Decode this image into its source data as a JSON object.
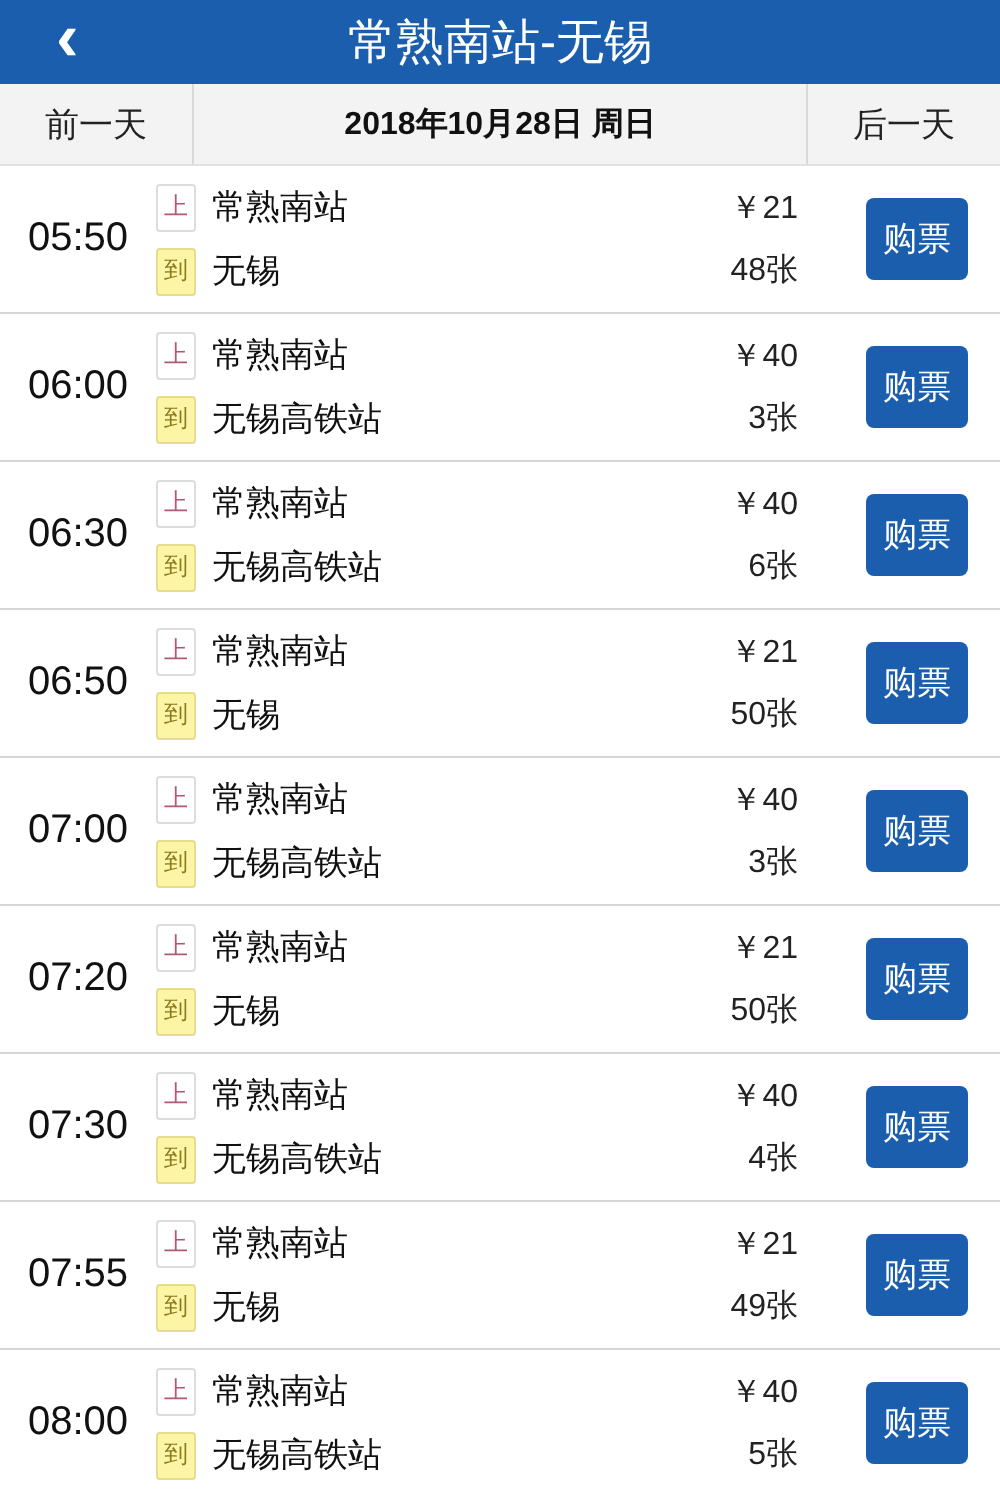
{
  "header": {
    "back": "‹",
    "title": "常熟南站-无锡"
  },
  "date_bar": {
    "prev": "前一天",
    "date": "2018年10月28日 周日",
    "next": "后一天"
  },
  "trains": [
    {
      "time": "05:50",
      "depart_tag": "上",
      "depart": "常熟南站",
      "arrive_tag": "到",
      "arrive": "无锡",
      "price": "￥21",
      "tickets": "48张",
      "button": "购票"
    },
    {
      "time": "06:00",
      "depart_tag": "上",
      "depart": "常熟南站",
      "arrive_tag": "到",
      "arrive": "无锡高铁站",
      "price": "￥40",
      "tickets": "3张",
      "button": "购票"
    },
    {
      "time": "06:30",
      "depart_tag": "上",
      "depart": "常熟南站",
      "arrive_tag": "到",
      "arrive": "无锡高铁站",
      "price": "￥40",
      "tickets": "6张",
      "button": "购票"
    },
    {
      "time": "06:50",
      "depart_tag": "上",
      "depart": "常熟南站",
      "arrive_tag": "到",
      "arrive": "无锡",
      "price": "￥21",
      "tickets": "50张",
      "button": "购票"
    },
    {
      "time": "07:00",
      "depart_tag": "上",
      "depart": "常熟南站",
      "arrive_tag": "到",
      "arrive": "无锡高铁站",
      "price": "￥40",
      "tickets": "3张",
      "button": "购票"
    },
    {
      "time": "07:20",
      "depart_tag": "上",
      "depart": "常熟南站",
      "arrive_tag": "到",
      "arrive": "无锡",
      "price": "￥21",
      "tickets": "50张",
      "button": "购票"
    },
    {
      "time": "07:30",
      "depart_tag": "上",
      "depart": "常熟南站",
      "arrive_tag": "到",
      "arrive": "无锡高铁站",
      "price": "￥40",
      "tickets": "4张",
      "button": "购票"
    },
    {
      "time": "07:55",
      "depart_tag": "上",
      "depart": "常熟南站",
      "arrive_tag": "到",
      "arrive": "无锡",
      "price": "￥21",
      "tickets": "49张",
      "button": "购票"
    },
    {
      "time": "08:00",
      "depart_tag": "上",
      "depart": "常熟南站",
      "arrive_tag": "到",
      "arrive": "无锡高铁站",
      "price": "￥40",
      "tickets": "5张",
      "button": "购票"
    }
  ]
}
